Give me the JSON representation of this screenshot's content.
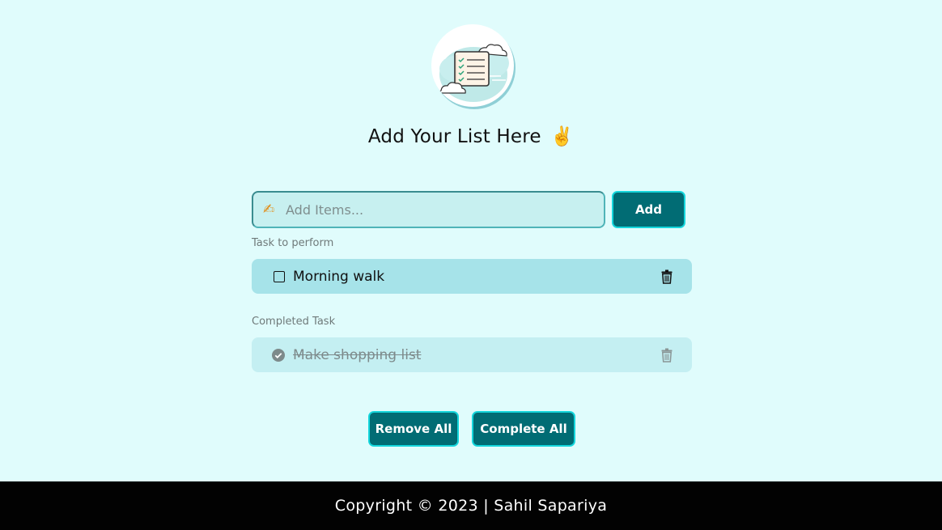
{
  "header": {
    "title": "Add Your List Here",
    "title_emoji": "✌️",
    "logo_icon": "checklist-clouds-icon"
  },
  "input": {
    "placeholder": "Add Items...",
    "value": "",
    "icon": "writing-hand-icon"
  },
  "buttons": {
    "add": "Add",
    "remove_all": "Remove All",
    "complete_all": "Complete All"
  },
  "sections": {
    "todo_label": "Task to perform",
    "done_label": "Completed Task"
  },
  "tasks_todo": [
    {
      "text": "Morning walk",
      "completed": false
    }
  ],
  "tasks_done": [
    {
      "text": "Make shopping list",
      "completed": true
    }
  ],
  "footer": {
    "text": "Copyright © 2023 | Sahil Sapariya"
  },
  "colors": {
    "background": "#e0fcfc",
    "primary_button": "#016c74",
    "button_border": "#15d6dc",
    "todo_row": "#a6e3e9",
    "done_row": "#c4eff2",
    "footer_bg": "#020202"
  }
}
